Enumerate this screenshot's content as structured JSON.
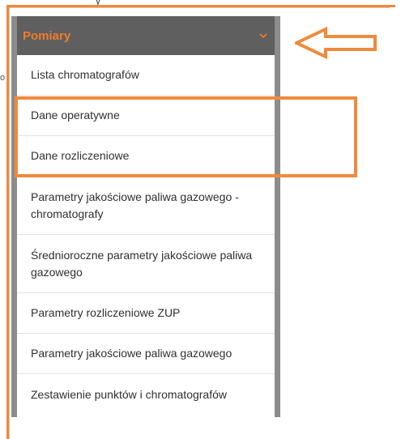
{
  "background": {
    "top_fragment": "y",
    "left_fragment": "o"
  },
  "dropdown": {
    "title": "Pomiary",
    "header_color": "#5f5f5f",
    "accent_color": "#f07b2d",
    "items": [
      {
        "label": "Lista chromatografów"
      },
      {
        "label": "Dane operatywne"
      },
      {
        "label": "Dane rozliczeniowe"
      },
      {
        "label": "Parametry jakościowe paliwa gazowego - chromatografy"
      },
      {
        "label": "Średnioroczne parametry jakościowe paliwa gazowego"
      },
      {
        "label": "Parametry rozliczeniowe ZUP"
      },
      {
        "label": "Parametry jakościowe paliwa gazowego"
      },
      {
        "label": "Zestawienie punktów i chromatografów"
      }
    ]
  },
  "annotations": {
    "highlight_color": "#f08a3c",
    "arrow_icon": "left-arrow-outline"
  }
}
